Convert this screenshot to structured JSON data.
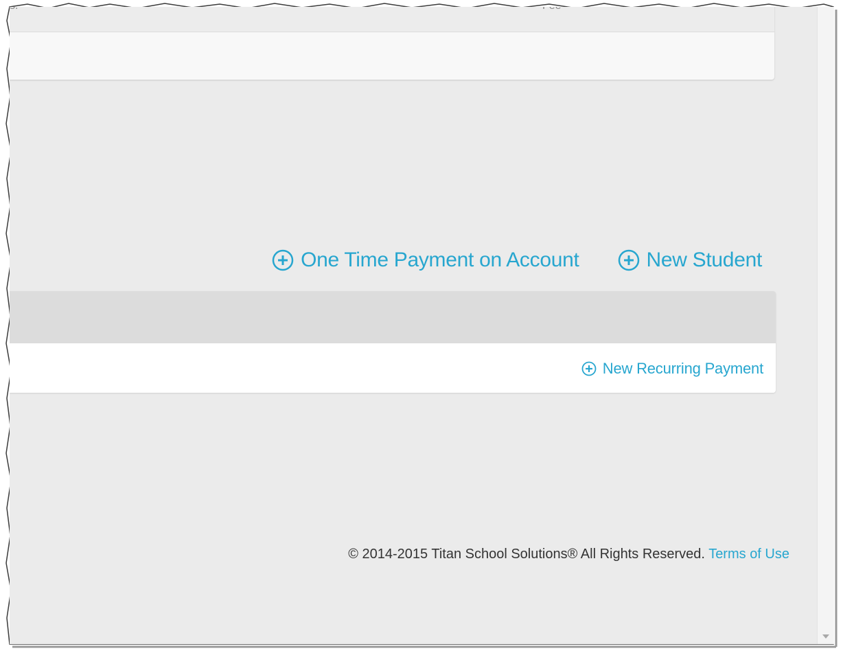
{
  "top_table": {
    "columns": [
      "s.",
      "Fee"
    ]
  },
  "actions": {
    "one_time_payment": "One Time Payment on Account",
    "new_student": "New Student"
  },
  "recurring": {
    "new_recurring_payment": "New Recurring Payment"
  },
  "footer": {
    "copyright": "© 2014-2015 Titan School Solutions® All Rights Reserved.",
    "terms": "Terms of Use"
  },
  "colors": {
    "accent": "#27a6cf",
    "background": "#ebebeb",
    "card_header": "#dcdcdc"
  },
  "icons": {
    "add": "circle-plus-icon"
  }
}
